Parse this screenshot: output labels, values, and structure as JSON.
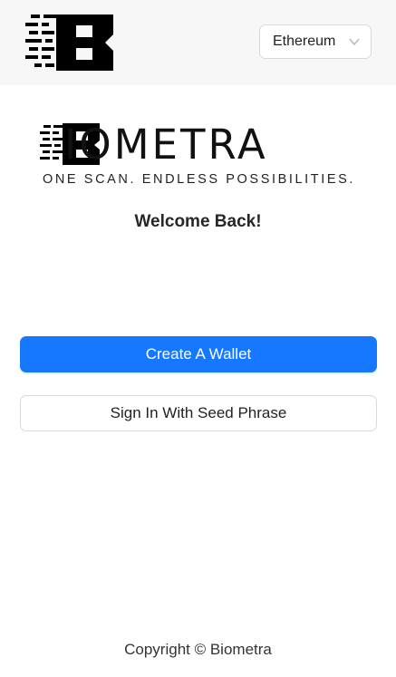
{
  "header": {
    "logo_icon": "biometra-b-logo-icon",
    "network_select": {
      "value": "Ethereum",
      "icon": "chevron-down-icon"
    }
  },
  "brand": {
    "wordmark": "IOMETRA",
    "tagline": "ONE SCAN. ENDLESS POSSIBILITIES."
  },
  "welcome": {
    "title": "Welcome Back!"
  },
  "actions": {
    "create_wallet_label": "Create A Wallet",
    "sign_in_seed_label": "Sign In With Seed Phrase"
  },
  "footer": {
    "copyright": "Copyright © Biometra"
  },
  "colors": {
    "primary": "#1677ff",
    "header_bg": "#f7f7f7",
    "border": "#d9d9d9"
  }
}
